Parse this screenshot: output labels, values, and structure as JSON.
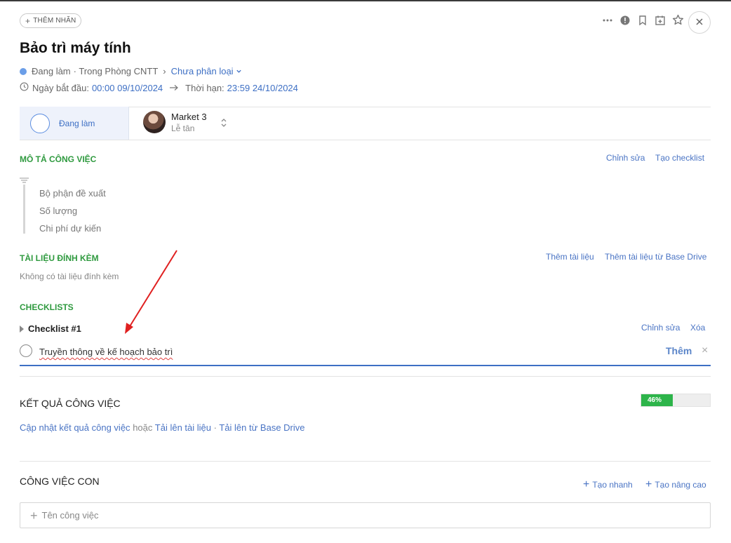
{
  "header": {
    "add_label_button": "THÊM NHÃN",
    "icons": [
      "more-icon",
      "alert-icon",
      "bookmark-icon",
      "calendar-icon",
      "star-icon",
      "close-icon"
    ]
  },
  "task": {
    "title": "Bảo trì máy tính",
    "status_text": "Đang làm",
    "location": "· Trong Phòng CNTT",
    "breadcrumb_arrow": "›",
    "category": "Chưa phân loại",
    "start_label": "Ngày bắt đầu:",
    "start_value": "00:00 09/10/2024",
    "deadline_label": "Thời hạn:",
    "deadline_value": "23:59 24/10/2024"
  },
  "status_panel": {
    "status_label": "Đang làm",
    "assignee_name": "Market 3",
    "assignee_role": "Lễ tân"
  },
  "description": {
    "title": "MÔ TẢ CÔNG VIỆC",
    "edit_link": "Chỉnh sửa",
    "checklist_link": "Tạo checklist",
    "items": [
      "Bộ phận đề xuất",
      "Số lượng",
      "Chi phí dự kiến"
    ]
  },
  "attachments": {
    "title": "TÀI LIỆU ĐÍNH KÈM",
    "add_link": "Thêm tài liệu",
    "add_drive_link": "Thêm tài liệu từ Base Drive",
    "empty_text": "Không có tài liệu đính kèm"
  },
  "checklists": {
    "title": "CHECKLISTS",
    "checklist_name": "Checklist #1",
    "edit_link": "Chỉnh sửa",
    "delete_link": "Xóa",
    "new_item_value": "Truyền thông về kế hoạch bảo trì",
    "add_button": "Thêm",
    "cancel_icon": "×"
  },
  "results": {
    "title": "KẾT QUẢ CÔNG VIỆC",
    "progress_percent": 46,
    "progress_label": "46%",
    "update_link": "Cập nhật kết quả công việc",
    "or_text": "hoặc",
    "upload_link": "Tải lên tài liệu",
    "dot": "·",
    "upload_drive_link": "Tải lên từ Base Drive"
  },
  "subtasks": {
    "title": "CÔNG VIỆC CON",
    "quick_create": "Tạo nhanh",
    "advanced_create": "Tạo nâng cao",
    "input_placeholder": "Tên công việc"
  },
  "colors": {
    "accent": "#3d6fc4",
    "section_green": "#2f9a3f",
    "progress_green": "#2db44a",
    "annotation_red": "#e02020"
  }
}
